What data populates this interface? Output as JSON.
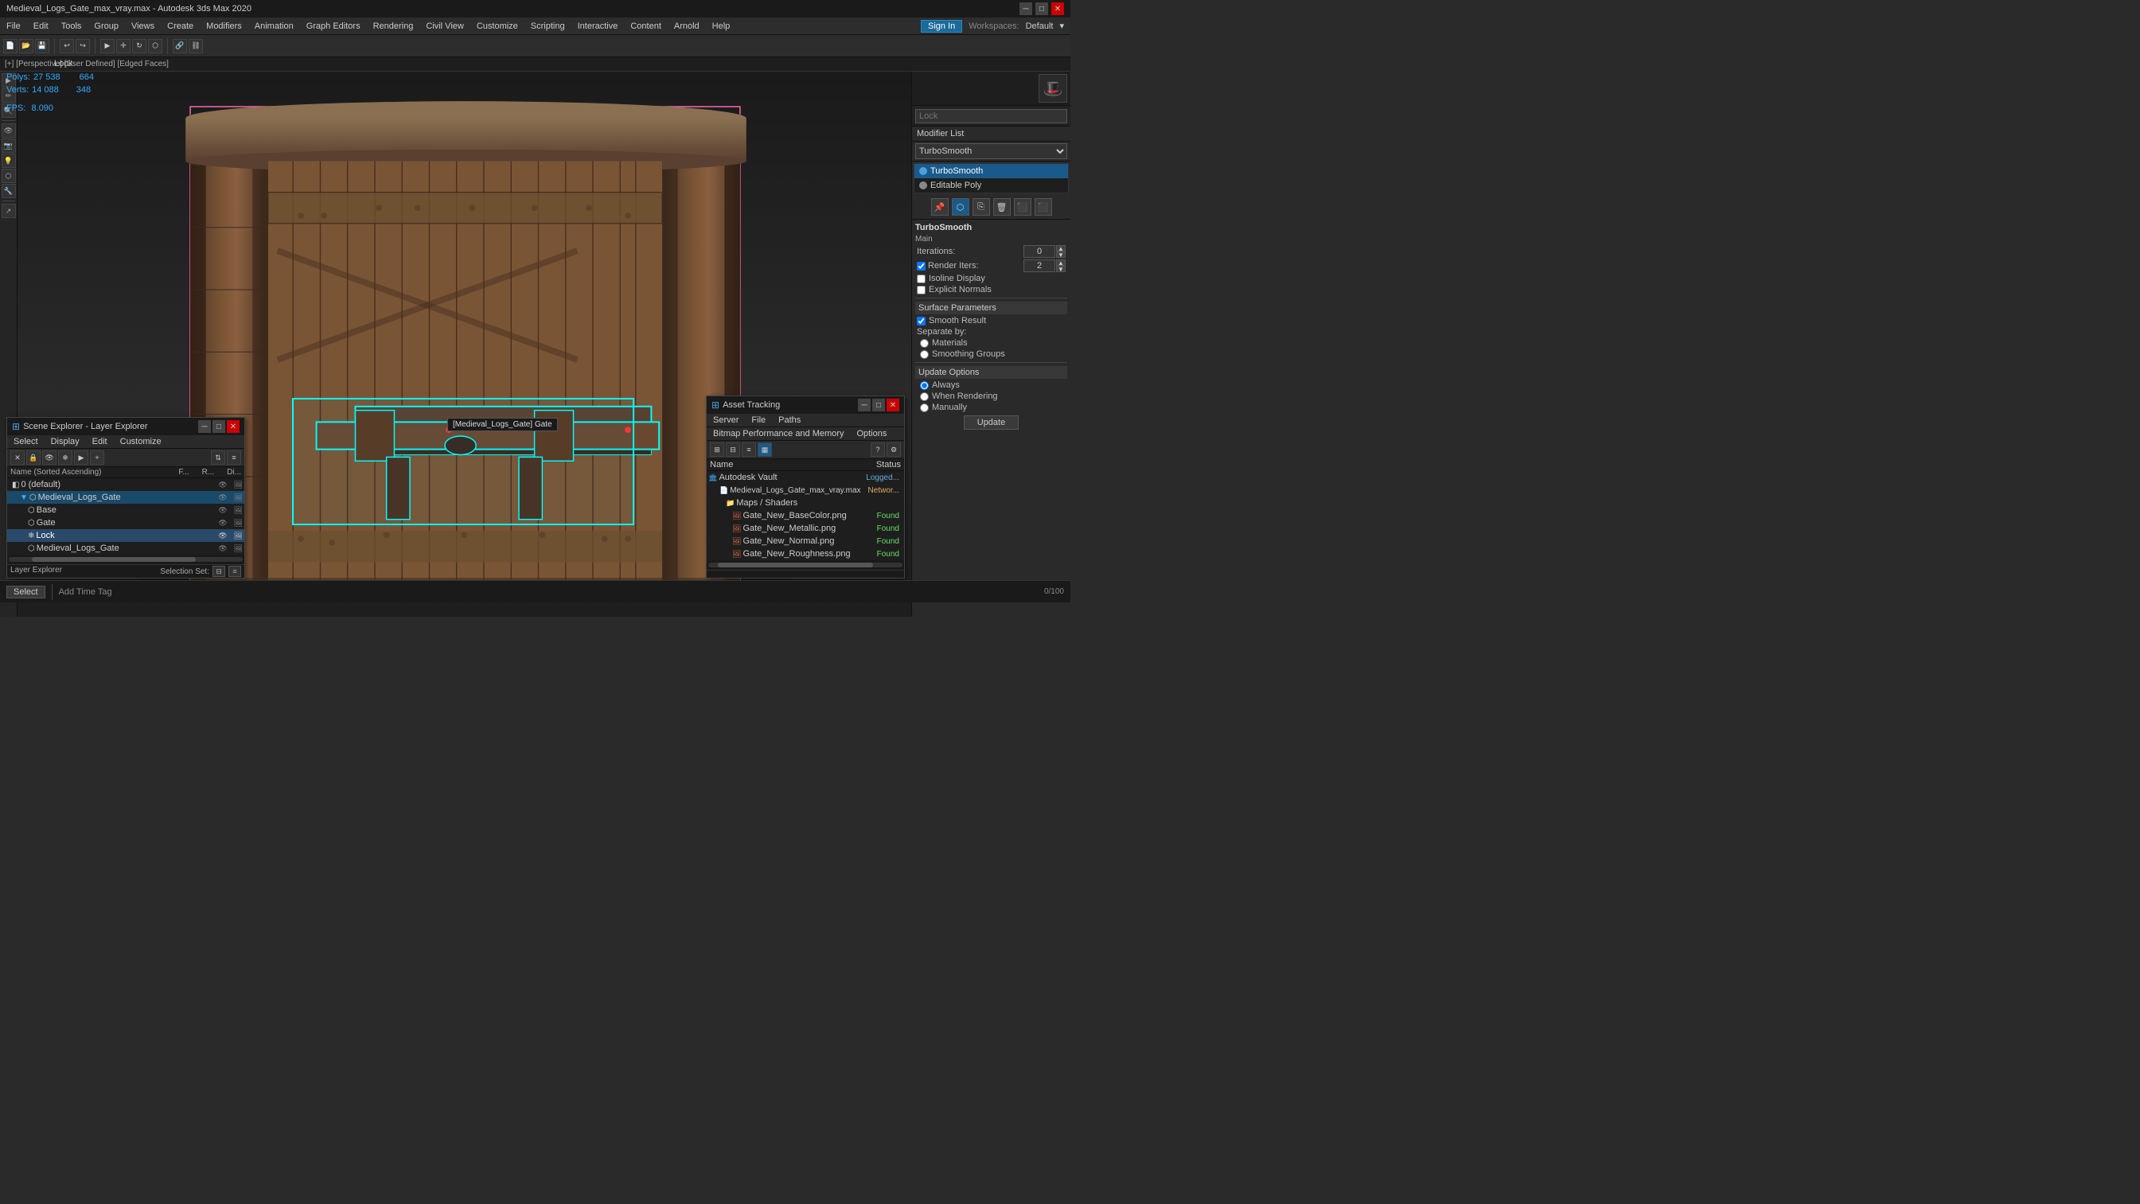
{
  "window": {
    "title": "Medieval_Logs_Gate_max_vray.max - Autodesk 3ds Max 2020",
    "controls": [
      "minimize",
      "maximize",
      "close"
    ]
  },
  "menubar": {
    "items": [
      "File",
      "Edit",
      "Tools",
      "Group",
      "Views",
      "Create",
      "Modifiers",
      "Animation",
      "Graph Editors",
      "Rendering",
      "Civil View",
      "Customize",
      "Scripting",
      "Interactive",
      "Content",
      "Arnold",
      "Help"
    ]
  },
  "workspace": {
    "label": "Workspaces:",
    "current": "Default"
  },
  "user": {
    "signin": "Sign In"
  },
  "viewport": {
    "label": "[+] [Perspective] [User Defined] [Edged Faces]",
    "stats": {
      "polys_label": "Polys:",
      "polys_total": "27 538",
      "polys_lock": "664",
      "verts_label": "Verts:",
      "verts_total": "14 088",
      "verts_lock": "348",
      "total_label": "Total",
      "lock_label": "Lock",
      "fps_label": "FPS:",
      "fps_value": "8.090"
    },
    "tooltip": "[Medieval_Logs_Gate] Gate"
  },
  "right_panel": {
    "lock_placeholder": "Lock",
    "modifier_list_label": "Modifier List",
    "modifiers": [
      {
        "name": "TurboSmooth",
        "active": true
      },
      {
        "name": "Editable Poly",
        "active": false
      }
    ],
    "turbosmooth": {
      "title": "TurboSmooth",
      "main_label": "Main",
      "iterations_label": "Iterations:",
      "iterations_value": "0",
      "render_iters_label": "Render Iters:",
      "render_iters_value": "2",
      "isoline_display_label": "Isoline Display",
      "explicit_normals_label": "Explicit Normals",
      "surface_params_label": "Surface Parameters",
      "smooth_result_label": "Smooth Result",
      "smooth_result_checked": true,
      "separate_by_label": "Separate by:",
      "materials_label": "Materials",
      "smoothing_groups_label": "Smoothing Groups",
      "update_options_label": "Update Options",
      "always_label": "Always",
      "when_rendering_label": "When Rendering",
      "manually_label": "Manually",
      "update_btn": "Update"
    }
  },
  "scene_explorer": {
    "title": "Scene Explorer - Layer Explorer",
    "menus": [
      "Select",
      "Display",
      "Edit",
      "Customize"
    ],
    "toolbar_icons": [
      "x",
      "lock",
      "vis",
      "freeze",
      "render",
      "add"
    ],
    "columns": {
      "name": "Name (Sorted Ascending)",
      "freeze": "F...",
      "render": "R...",
      "display": "Di..."
    },
    "tree": [
      {
        "indent": 0,
        "icon": "layer",
        "name": "0 (default)",
        "visible": true
      },
      {
        "indent": 1,
        "icon": "mesh",
        "name": "Medieval_Logs_Gate",
        "visible": true,
        "selected": true
      },
      {
        "indent": 2,
        "icon": "mesh",
        "name": "Base",
        "visible": true
      },
      {
        "indent": 2,
        "icon": "mesh",
        "name": "Gate",
        "visible": true
      },
      {
        "indent": 2,
        "icon": "mesh",
        "name": "Lock",
        "visible": true,
        "highlighted": true
      },
      {
        "indent": 2,
        "icon": "mesh",
        "name": "Medieval_Logs_Gate",
        "visible": true
      }
    ],
    "status_left": "Layer Explorer",
    "status_right": "Selection Set:"
  },
  "asset_tracking": {
    "title": "Asset Tracking",
    "menus": [
      "Server",
      "File",
      "Paths"
    ],
    "submenus": [
      "Bitmap Performance and Memory",
      "Options"
    ],
    "columns": {
      "name": "Name",
      "status": "Status"
    },
    "tree": [
      {
        "indent": 0,
        "icon": "vault",
        "name": "Autodesk Vault",
        "status": "Logged...",
        "status_type": "logged"
      },
      {
        "indent": 1,
        "icon": "file",
        "name": "Medieval_Logs_Gate_max_vray.max",
        "status": "Networ...",
        "status_type": "netw"
      },
      {
        "indent": 2,
        "icon": "folder",
        "name": "Maps / Shaders",
        "status": "",
        "status_type": ""
      },
      {
        "indent": 3,
        "icon": "img",
        "name": "Gate_New_BaseColor.png",
        "status": "Found",
        "status_type": "found"
      },
      {
        "indent": 3,
        "icon": "img",
        "name": "Gate_New_Metallic.png",
        "status": "Found",
        "status_type": "found"
      },
      {
        "indent": 3,
        "icon": "img",
        "name": "Gate_New_Normal.png",
        "status": "Found",
        "status_type": "found"
      },
      {
        "indent": 3,
        "icon": "img",
        "name": "Gate_New_Roughness.png",
        "status": "Found",
        "status_type": "found"
      }
    ]
  },
  "statusbar": {
    "select_btn": "Select",
    "selection_set_label": "Selection Set:"
  }
}
